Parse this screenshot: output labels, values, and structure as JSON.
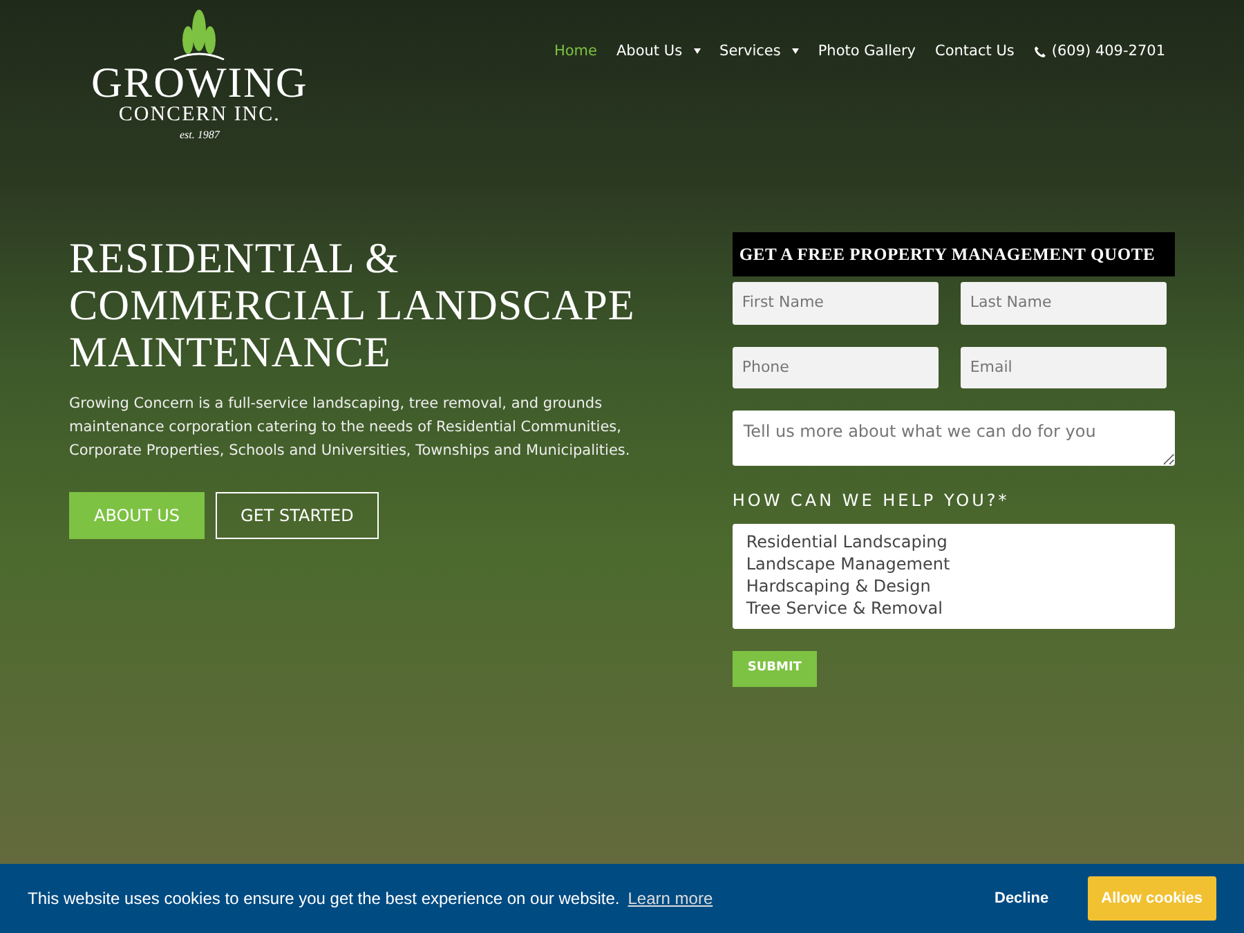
{
  "logo": {
    "name": "GROWING",
    "subname": "CONCERN INC.",
    "established": "est. 1987"
  },
  "nav": [
    {
      "label": "Home",
      "selected": true,
      "dropdown": false
    },
    {
      "label": "About Us",
      "selected": false,
      "dropdown": true
    },
    {
      "label": "Services",
      "selected": false,
      "dropdown": true
    },
    {
      "label": "Photo Gallery",
      "selected": false,
      "dropdown": false
    },
    {
      "label": "Contact Us",
      "selected": false,
      "dropdown": false
    }
  ],
  "phone": "(609) 409-2701",
  "hero": {
    "title": "RESIDENTIAL & COMMERCIAL LANDSCAPE MAINTENANCE",
    "text": "Growing Concern is a full-service landscaping, tree removal, and grounds maintenance corporation catering to the needs of Residential Communities, Corporate Properties, Schools and Universities, Townships and Municipalities.",
    "buttons": [
      {
        "label": "ABOUT US",
        "kind": "filled"
      },
      {
        "label": "GET STARTED",
        "kind": "outline"
      }
    ]
  },
  "quote_form": {
    "title": "GET A FREE PROPERTY MANAGEMENT QUOTE",
    "fields": [
      {
        "placeholder": "First Name"
      },
      {
        "placeholder": "Last Name"
      },
      {
        "placeholder": "Phone"
      },
      {
        "placeholder": "Email"
      }
    ],
    "message": {
      "placeholder": "Tell us more about what we can do for you"
    },
    "help_label": "HOW CAN WE HELP YOU?*",
    "options": [
      "Residential Landscaping",
      "Landscape Management",
      "Hardscaping & Design",
      "Tree Service & Removal"
    ],
    "submit": "SUBMIT"
  },
  "cookie_bar": {
    "text": "This website uses cookies to ensure you get the best experience on our website.",
    "link": "Learn more",
    "decline": "Decline",
    "allow": "Allow cookies"
  }
}
